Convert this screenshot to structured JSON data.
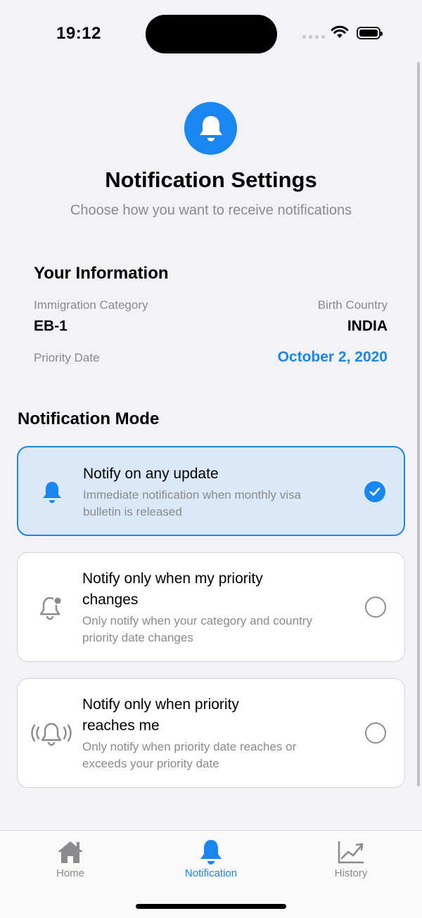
{
  "status_bar": {
    "time": "19:12"
  },
  "header": {
    "title": "Notification Settings",
    "subtitle": "Choose how you want to receive notifications",
    "icon": "bell-icon",
    "accent": "#1a86f0"
  },
  "info": {
    "title": "Your Information",
    "category_label": "Immigration Category",
    "category_value": "EB-1",
    "country_label": "Birth Country",
    "country_value": "INDIA",
    "priority_label": "Priority Date",
    "priority_value": "October 2, 2020"
  },
  "mode": {
    "title": "Notification Mode",
    "options": [
      {
        "title": "Notify on any update",
        "desc": "Immediate notification when monthly visa bulletin is released",
        "icon": "bell-fill-icon",
        "selected": true
      },
      {
        "title": "Notify only when my priority changes",
        "desc": "Only notify when your category and country priority date changes",
        "icon": "bell-badge-icon",
        "selected": false
      },
      {
        "title": "Notify only when priority reaches me",
        "desc": "Only notify when priority date reaches or exceeds your priority date",
        "icon": "bell-ringing-icon",
        "selected": false
      }
    ]
  },
  "tabs": [
    {
      "label": "Home",
      "icon": "house-icon",
      "active": false
    },
    {
      "label": "Notification",
      "icon": "bell-icon",
      "active": true
    },
    {
      "label": "History",
      "icon": "chart-icon",
      "active": false
    }
  ]
}
